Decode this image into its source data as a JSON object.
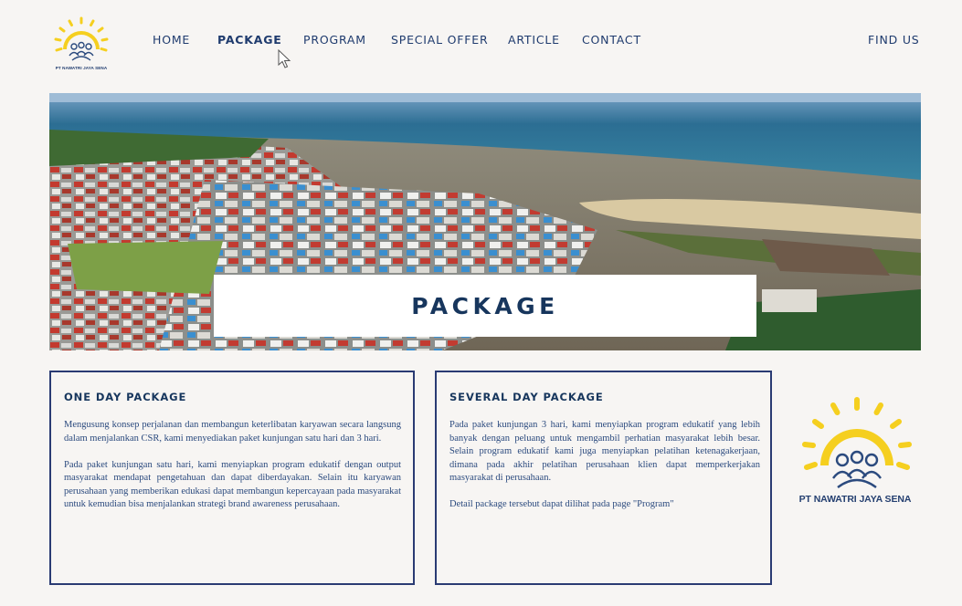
{
  "brand": {
    "name_small": "PT NAWATRI JAYA SENA",
    "name_large": "PT NAWATRI JAYA SENA"
  },
  "nav": {
    "items": [
      {
        "label": "HOME",
        "active": false
      },
      {
        "label": "PACKAGE",
        "active": true
      },
      {
        "label": "PROGRAM",
        "active": false
      },
      {
        "label": "SPECIAL OFFER",
        "active": false
      },
      {
        "label": "ARTICLE",
        "active": false
      },
      {
        "label": "CONTACT",
        "active": false
      }
    ],
    "find_us": "FIND US"
  },
  "hero": {
    "title": "PACKAGE"
  },
  "cards": [
    {
      "title": "ONE DAY PACKAGE",
      "paragraphs": [
        "Mengusung konsep perjalanan dan membangun keterlibatan karyawan secara langsung dalam menjalankan CSR, kami menyediakan paket kunjungan satu hari dan 3 hari.",
        "Pada paket kunjungan satu hari, kami menyiapkan program edukatif dengan output masyarakat mendapat pengetahuan dan dapat diberdayakan. Selain itu karyawan perusahaan yang memberikan edukasi dapat membangun kepercayaan pada masyarakat untuk kemudian bisa menjalankan strategi brand awareness perusahaan."
      ]
    },
    {
      "title": "SEVERAL DAY PACKAGE",
      "paragraphs": [
        "Pada paket kunjungan 3 hari, kami menyiapkan program edukatif yang lebih banyak dengan peluang untuk mengambil perhatian masyarakat lebih besar. Selain program edukatif kami juga menyiapkan pelatihan ketenagakerjaan, dimana pada akhir pelatihan perusahaan klien dapat memperkerjakan masyarakat di perusahaan.",
        "Detail package tersebut dapat dilihat pada page \"Program\""
      ]
    }
  ],
  "colors": {
    "navy": "#17365d",
    "text_blue": "#2b4a7e",
    "border": "#2a3b73",
    "sun_yellow": "#f5cf1f",
    "background": "#f7f5f3"
  },
  "icons": [
    "sun-people-logo-icon",
    "mouse-cursor-icon"
  ]
}
